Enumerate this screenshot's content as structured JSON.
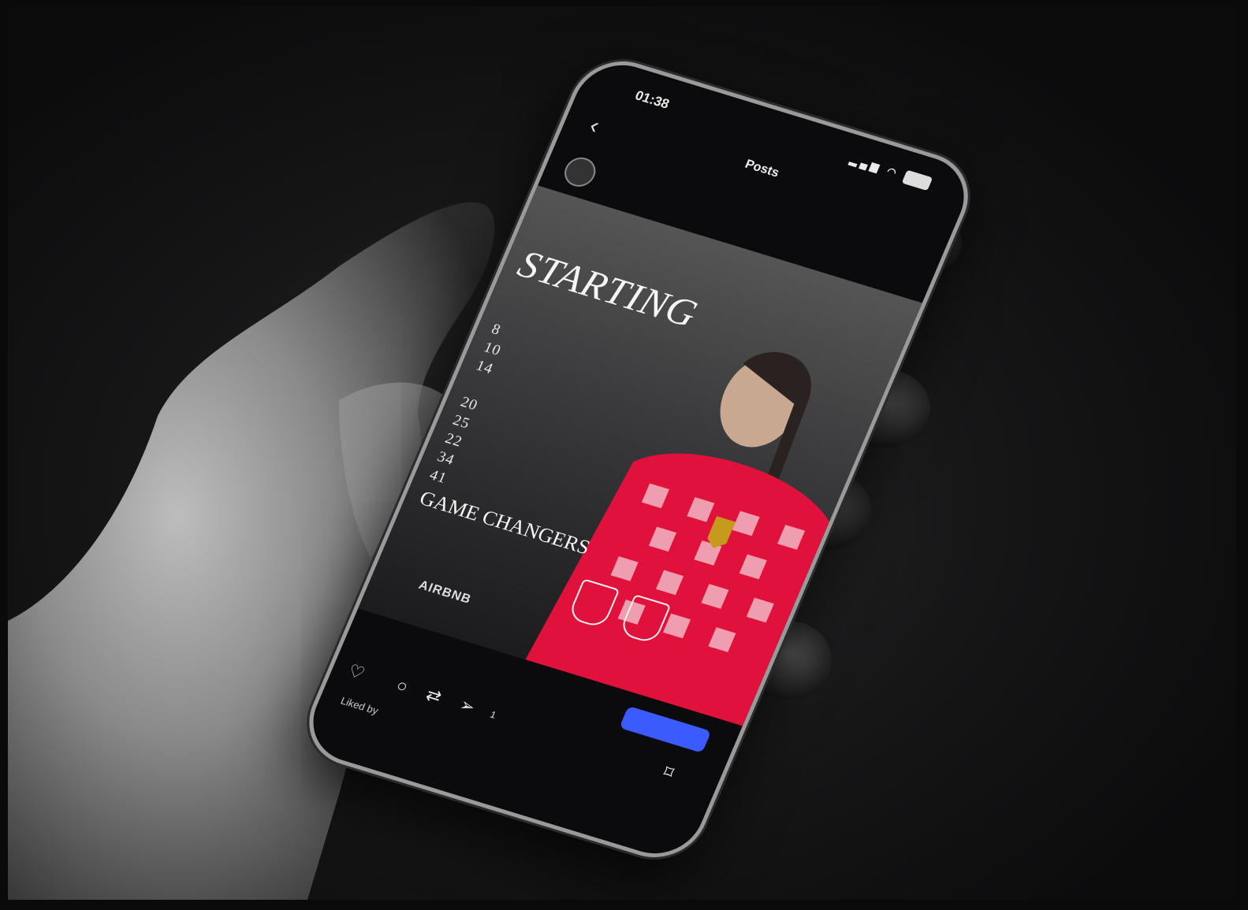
{
  "status_bar": {
    "time": "01:38",
    "signal": "",
    "battery": ""
  },
  "nav": {
    "back": "‹",
    "title": "Posts",
    "subtitle": ""
  },
  "post": {
    "username": "",
    "lineup": {
      "heading": "STARTING",
      "players": [
        "",
        "",
        "8",
        "10",
        "14",
        "",
        "20",
        "25",
        "22",
        "34",
        "41"
      ],
      "subs_heading": "GAME CHANGERS"
    },
    "sponsor": "AIRBNB",
    "date": "",
    "cta_label": "",
    "like_count": "",
    "share_count": "1",
    "likes_text": "Liked by"
  },
  "colors": {
    "accent": "#3b5bff",
    "kit": "#e0123c",
    "kit_light": "#f3c2cc"
  },
  "icons": [
    "back-icon",
    "heart-icon",
    "comment-icon",
    "repost-icon",
    "share-icon",
    "bookmark-icon"
  ]
}
